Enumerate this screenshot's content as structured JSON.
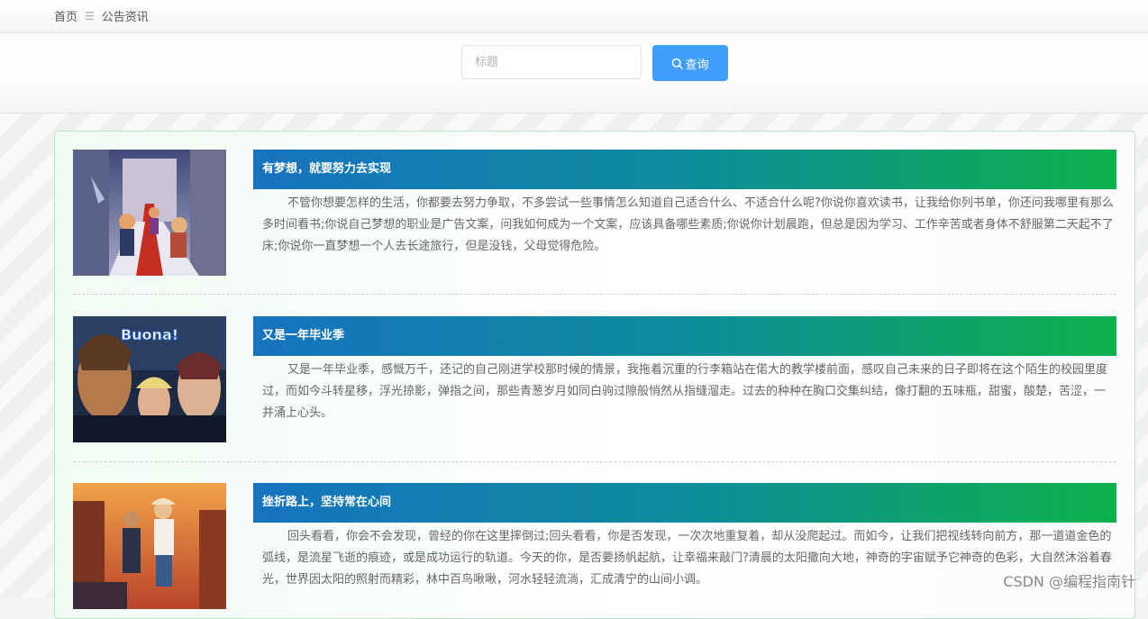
{
  "breadcrumb": {
    "home": "首页",
    "separator": "☰",
    "current": "公告资讯"
  },
  "search": {
    "placeholder": "标题",
    "value": "",
    "button_label": "查询"
  },
  "colors": {
    "primary": "#409eff",
    "header_start": "#1673c0",
    "header_end": "#0db14b",
    "panel_border": "#b9e6c6"
  },
  "news": [
    {
      "title": "有梦想，就要努力去实现",
      "summary": "不管你想要怎样的生活，你都要去努力争取，不多尝试一些事情怎么知道自己适合什么、不适合什么呢?你说你喜欢读书，让我给你列书单，你还问我哪里有那么多时间看书;你说自己梦想的职业是广告文案，问我如何成为一个文案，应该具备哪些素质;你说你计划晨跑，但总是因为学习、工作辛苦或者身体不舒服第二天起不了床;你说你一直梦想一个人去长途旅行，但是没钱，父母觉得危险。"
    },
    {
      "title": "又是一年毕业季",
      "summary": "又是一年毕业季，感慨万千，还记的自己刚进学校那时候的情景，我拖着沉重的行李箱站在偌大的教学楼前面，感叹自己未来的日子即将在这个陌生的校园里度过，而如今斗转星移，浮光掠影，弹指之间，那些青葱岁月如同白驹过隙般悄然从指缝溜走。过去的种种在胸口交集纠结，像打翻的五味瓶，甜蜜，酸楚，苦涩，一并涌上心头。",
      "image_text": "Buona!"
    },
    {
      "title": "挫折路上，坚持常在心间",
      "summary": "回头看看，你会不会发现，曾经的你在这里摔倒过;回头看看，你是否发现，一次次地重复着，却从没爬起过。而如今，让我们把视线转向前方，那一道道金色的弧线，是流星飞逝的痕迹，或是成功运行的轨道。今天的你，是否要扬帆起航，让幸福来敲门?清晨的太阳撒向大地，神奇的宇宙赋予它神奇的色彩，大自然沐浴着春光，世界因太阳的照射而精彩，林中百鸟啾啾，河水轻轻流淌，汇成清宁的山间小调。"
    }
  ],
  "watermark": "CSDN @编程指南针"
}
